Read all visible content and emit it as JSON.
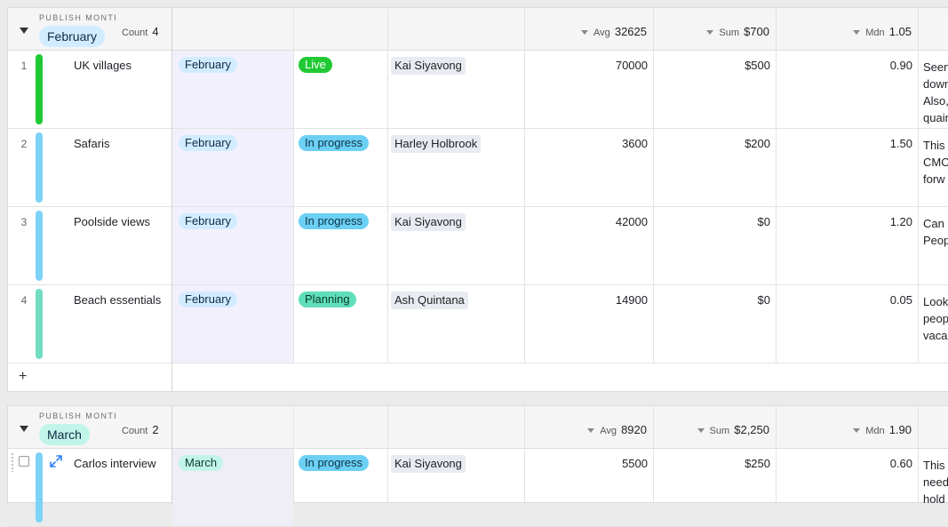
{
  "groups": [
    {
      "field_label": "PUBLISH MONTH",
      "value": "February",
      "count_label": "Count",
      "count": "4",
      "avg_label": "Avg",
      "avg": "32625",
      "sum_label": "Sum",
      "sum": "$700",
      "mdn_label": "Mdn",
      "mdn": "1.05",
      "add_label": "+",
      "rows": [
        {
          "num": "1",
          "name": "UK villages",
          "month": "February",
          "status": "Live",
          "owner": "Kai Siyavong",
          "views": "70000",
          "budget": "$500",
          "ratio": "0.90",
          "notes": [
            "Seen",
            "down",
            "Also,",
            "quain"
          ]
        },
        {
          "num": "2",
          "name": "Safaris",
          "month": "February",
          "status": "In progress",
          "owner": "Harley Holbrook",
          "views": "3600",
          "budget": "$200",
          "ratio": "1.50",
          "notes": [
            "This",
            "CMO",
            "forw"
          ]
        },
        {
          "num": "3",
          "name": "Poolside views",
          "month": "February",
          "status": "In progress",
          "owner": "Kai Siyavong",
          "views": "42000",
          "budget": "$0",
          "ratio": "1.20",
          "notes": [
            "Can",
            "Peop"
          ]
        },
        {
          "num": "4",
          "name": "Beach essentials",
          "month": "February",
          "status": "Planning",
          "owner": "Ash Quintana",
          "views": "14900",
          "budget": "$0",
          "ratio": "0.05",
          "notes": [
            "Look",
            "peop",
            "vaca"
          ]
        }
      ]
    },
    {
      "field_label": "PUBLISH MONTH",
      "value": "March",
      "count_label": "Count",
      "count": "2",
      "avg_label": "Avg",
      "avg": "8920",
      "sum_label": "Sum",
      "sum": "$2,250",
      "mdn_label": "Mdn",
      "mdn": "1.90",
      "rows": [
        {
          "num": "",
          "name": "Carlos interview",
          "month": "March",
          "status": "In progress",
          "owner": "Kai Siyavong",
          "views": "5500",
          "budget": "$250",
          "ratio": "0.60",
          "notes": [
            "This",
            "need",
            "hold"
          ]
        }
      ]
    }
  ],
  "icons": {
    "group_toggle": "caret-down-icon",
    "add_record": "plus-icon",
    "expand_record": "expand-arrows-icon",
    "drag_handle": "drag-handle-icon"
  },
  "colors": {
    "live_bg": "#20c933",
    "live_fg": "#ffffff",
    "in_progress_bg": "#6cd0f4",
    "in_progress_fg": "#0d3348",
    "planning_bg": "#5fdfb9",
    "planning_fg": "#0b3b2e",
    "bar_live": "#20c933",
    "bar_in_progress": "#7cd3f7",
    "bar_planning": "#72ddc3",
    "february_pill": "#d1ecff",
    "march_pill": "#c2f5e9"
  }
}
